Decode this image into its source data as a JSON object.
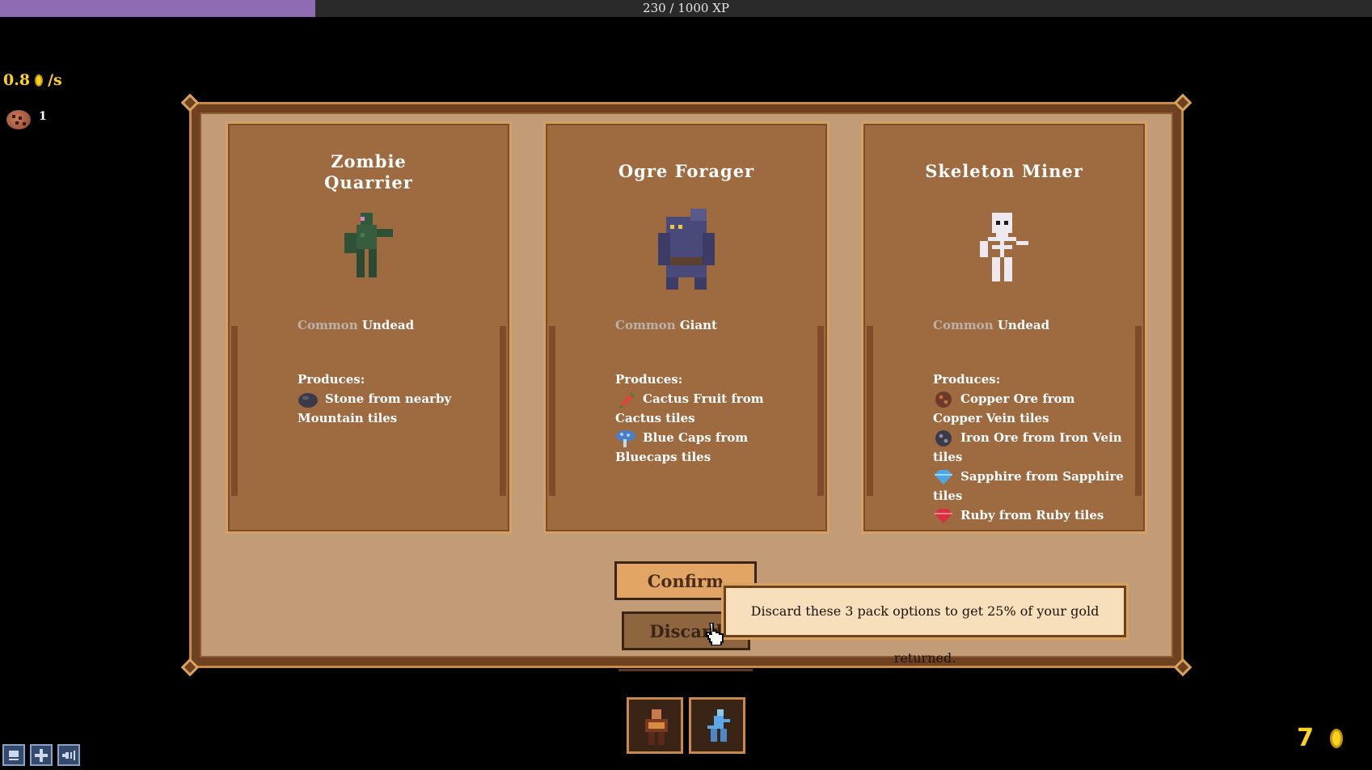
{
  "xp": {
    "text": "230 / 1000 XP",
    "current": 230,
    "max": 1000
  },
  "hud": {
    "rate_value": "0.8",
    "rate_unit": "/s",
    "cookie_count": "1",
    "gold": "7"
  },
  "cards": [
    {
      "title_line1": "Zombie",
      "title_line2": "Quarrier",
      "rarity": "Common",
      "race": "Undead",
      "produces_label": "Produces:",
      "produces": [
        {
          "icon": "stone-icon",
          "text": "Stone from nearby Mountain tiles"
        }
      ]
    },
    {
      "title_line1": "Ogre Forager",
      "title_line2": "",
      "rarity": "Common",
      "race": "Giant",
      "produces_label": "Produces:",
      "produces": [
        {
          "icon": "cactus-fruit-icon",
          "text": "Cactus Fruit from Cactus tiles"
        },
        {
          "icon": "blue-caps-icon",
          "text": "Blue Caps from Bluecaps tiles"
        }
      ]
    },
    {
      "title_line1": "Skeleton Miner",
      "title_line2": "",
      "rarity": "Common",
      "race": "Undead",
      "produces_label": "Produces:",
      "produces": [
        {
          "icon": "copper-ore-icon",
          "text": "Copper Ore from Copper Vein tiles"
        },
        {
          "icon": "iron-ore-icon",
          "text": "Iron Ore from Iron Vein tiles"
        },
        {
          "icon": "sapphire-icon",
          "text": "Sapphire from Sapphire tiles"
        },
        {
          "icon": "ruby-icon",
          "text": "Ruby from Ruby tiles"
        }
      ]
    }
  ],
  "buttons": {
    "confirm": "Confirm",
    "discard": "Discard"
  },
  "tooltip": "Discard these 3 pack options to get 25% of your gold returned.",
  "colors": {
    "xp_fill": "#8f6bb3",
    "gold": "#ffd21f",
    "panel": "#c19c77",
    "card": "#9e6a40"
  }
}
